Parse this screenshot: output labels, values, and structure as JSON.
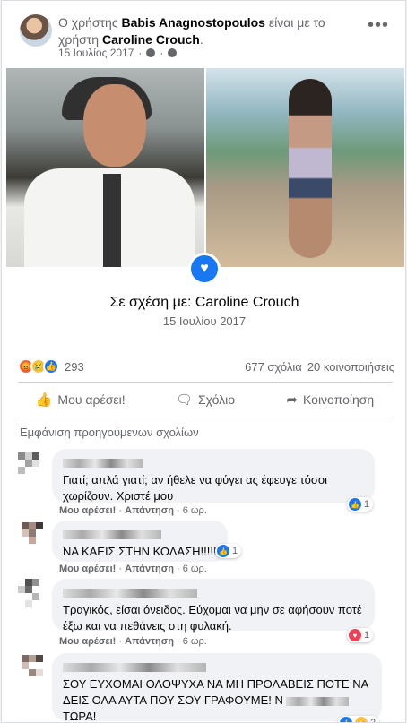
{
  "post": {
    "prefix": "Ο χρήστης",
    "author": "Babis Anagnostopoulos",
    "middle": "είναι με το χρήστη",
    "tagged": "Caroline Crouch",
    "tagged_suffix": ".",
    "date": "15 Ιουλίος 2017",
    "more": "•••"
  },
  "relationship": {
    "title": "Σε σχέση με: Caroline Crouch",
    "date": "15 Ιουλίου 2017"
  },
  "stats": {
    "reaction_count": "293",
    "comments": "677 σχόλια",
    "shares": "20 κοινοποιήσεις",
    "reaction_icons": [
      "angry-icon",
      "sad-icon",
      "like-icon"
    ]
  },
  "actions": {
    "like": "Μου αρέσει!",
    "comment": "Σχόλιο",
    "share": "Κοινοποίηση"
  },
  "prev_comments": "Εμφάνιση προηγούμενων σχολίων",
  "comments": [
    {
      "text": "Γιατί; απλά γιατί; αν ήθελε να φύγει ας έφευγε τόσοι χωρίζουν. Χριστέ μου",
      "like": "Μου αρέσει!",
      "reply": "Απάντηση",
      "time": "6 ώρ.",
      "reaction": "like",
      "count": "1"
    },
    {
      "text": "ΝΑ ΚΑΕΙΣ ΣΤΗΝ ΚΟΛΑΣΗ!!!!!",
      "like": "Μου αρέσει!",
      "reply": "Απάντηση",
      "time": "6 ώρ.",
      "reaction": "like",
      "count": "1"
    },
    {
      "text": "Τραγικός, είσαι όνειδος. Εύχομαι να μην σε αφήσουν ποτέ έξω και να πεθάνεις στη φυλακή.",
      "like": "Μου αρέσει!",
      "reply": "Απάντηση",
      "time": "6 ώρ.",
      "reaction": "heart",
      "count": "1"
    },
    {
      "text": "ΣΟΥ ΕΥΧΟΜΑΙ ΟΛΟΨΥΧΑ ΝΑ ΜΗ ΠΡΟΛΑΒΕΙΣ ΠΟΤΕ ΝΑ ΔΕΙΣ ΟΛΑ ΑΥΤΑ ΠΟΥ ΣΟΥ ΓΡΑΦΟΥΜΕ! Ν",
      "text2": "ΤΩΡΑ!",
      "reaction": "like",
      "count": "2"
    }
  ],
  "colors": {
    "accent": "#1877f2",
    "secondary_text": "#65676b",
    "bubble": "#f0f2f5"
  }
}
